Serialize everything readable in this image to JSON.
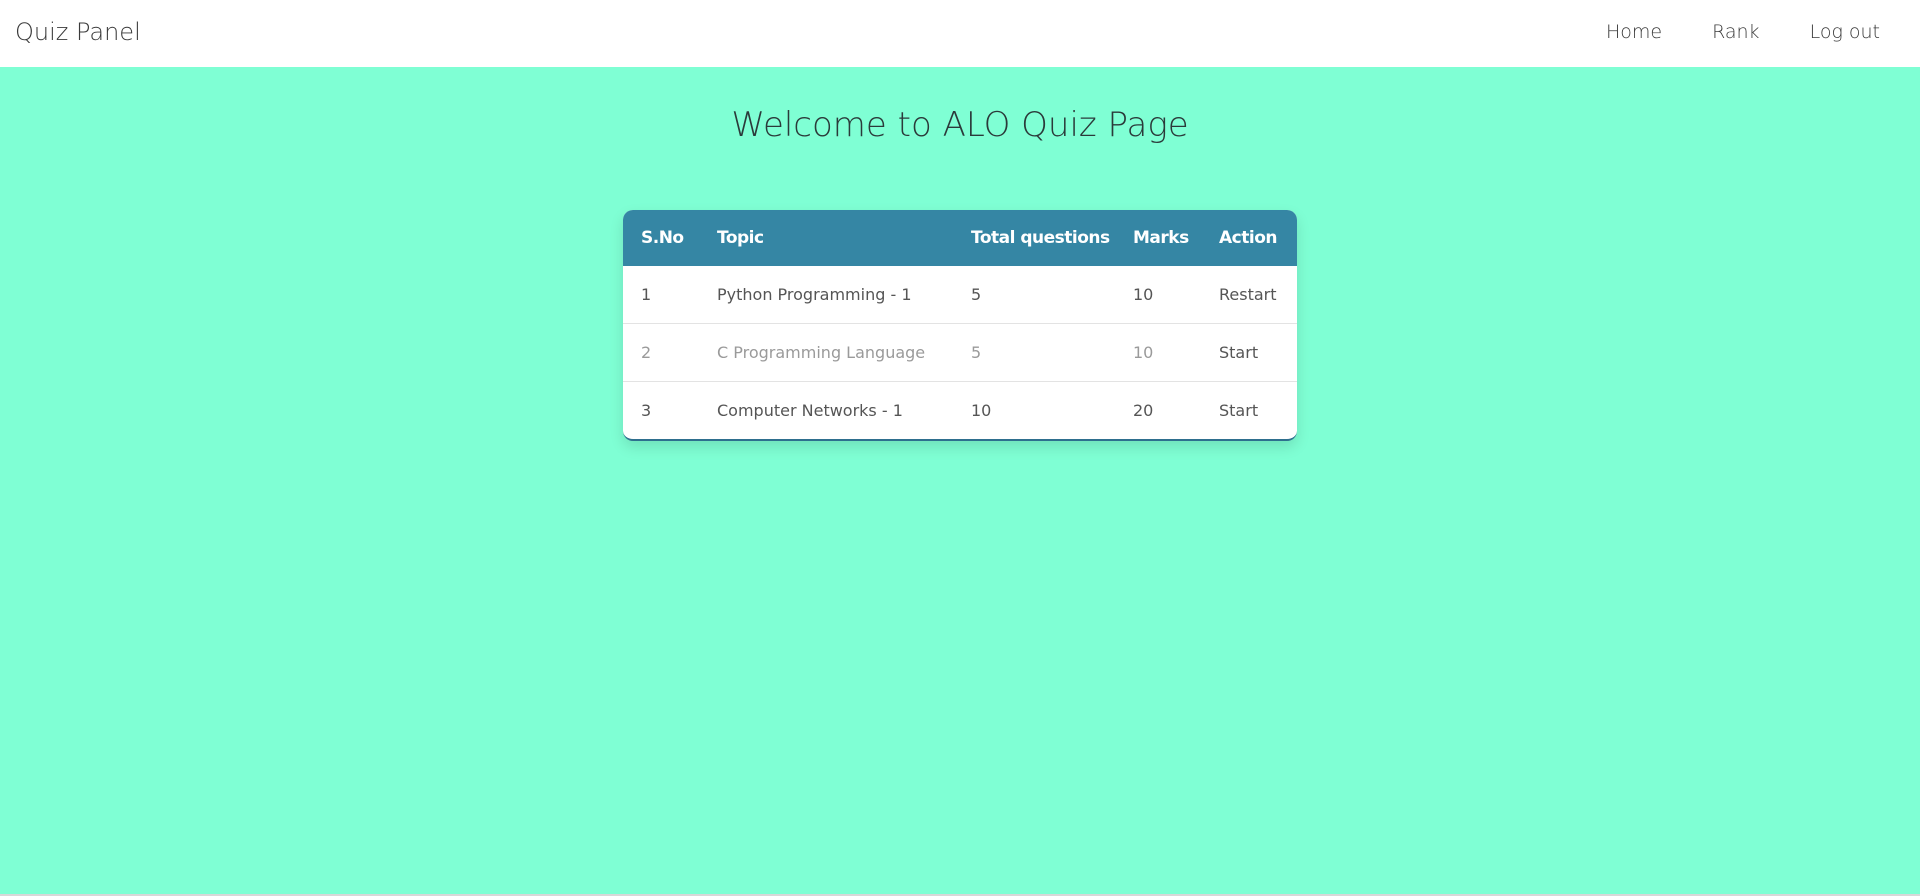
{
  "navbar": {
    "brand": "Quiz Panel",
    "links": [
      "Home",
      "Rank",
      "Log out"
    ]
  },
  "page_title": "Welcome to ALO Quiz Page",
  "table": {
    "headers": [
      "S.No",
      "Topic",
      "Total questions",
      "Marks",
      "Action"
    ],
    "rows": [
      {
        "sno": "1",
        "topic": "Python Programming - 1",
        "total": "5",
        "marks": "10",
        "action": "Restart"
      },
      {
        "sno": "2",
        "topic": "C Programming Language",
        "total": "5",
        "marks": "10",
        "action": "Start"
      },
      {
        "sno": "3",
        "topic": "Computer Networks - 1",
        "total": "10",
        "marks": "20",
        "action": "Start"
      }
    ]
  },
  "colors": {
    "navbar_bg": "#ffffff",
    "page_bg": "#7fffd4",
    "table_header_bg": "#3586a4",
    "table_header_text": "#ffffff"
  }
}
